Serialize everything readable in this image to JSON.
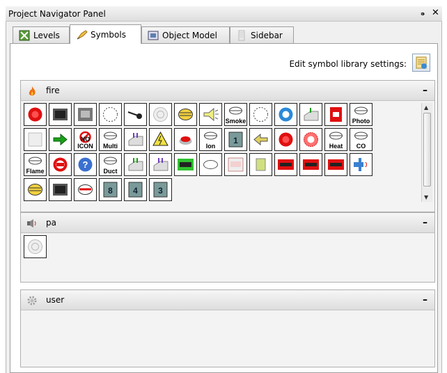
{
  "panel": {
    "title": "Project Navigator Panel",
    "float_icon": "restore-icon",
    "close_icon": "close-icon"
  },
  "tabs": [
    {
      "label": "Levels",
      "icon": "levels-icon",
      "active": false
    },
    {
      "label": "Symbols",
      "icon": "symbols-icon",
      "active": true
    },
    {
      "label": "Object Model",
      "icon": "object-model-icon",
      "active": false
    },
    {
      "label": "Sidebar",
      "icon": "sidebar-icon",
      "active": false
    }
  ],
  "settings": {
    "label": "Edit symbol library settings:",
    "icon": "settings-library-icon"
  },
  "sections": {
    "fire": {
      "label": "fire",
      "icon": "flame-icon",
      "minimize": "–"
    },
    "pa": {
      "label": "pa",
      "icon": "speaker-icon",
      "minimize": "–"
    },
    "user": {
      "label": "user",
      "icon": "gear-icon",
      "minimize": "–"
    }
  },
  "fire_symbols": [
    {
      "name": "red-light-symbol",
      "cap": ""
    },
    {
      "name": "panel-chip-symbol",
      "cap": ""
    },
    {
      "name": "control-panel-symbol",
      "cap": ""
    },
    {
      "name": "dotted-circle-symbol",
      "cap": ""
    },
    {
      "name": "pull-station-symbol",
      "cap": ""
    },
    {
      "name": "target-circle-symbol",
      "cap": ""
    },
    {
      "name": "yellow-detector-symbol",
      "cap": ""
    },
    {
      "name": "speaker-horn-symbol",
      "cap": ""
    },
    {
      "name": "smoke-detector-symbol",
      "cap": "Smoke"
    },
    {
      "name": "dotted-circle-2-symbol",
      "cap": ""
    },
    {
      "name": "blue-sensor-symbol",
      "cap": ""
    },
    {
      "name": "module-up-symbol",
      "cap": ""
    },
    {
      "name": "fire-alarm-box-symbol",
      "cap": ""
    },
    {
      "name": "photo-detector-symbol",
      "cap": "Photo"
    },
    {
      "name": "blank-panel-symbol",
      "cap": ""
    },
    {
      "name": "green-arrow-symbol",
      "cap": ""
    },
    {
      "name": "no-icon-symbol",
      "cap": "NO ICON"
    },
    {
      "name": "multi-detector-symbol",
      "cap": "Multi"
    },
    {
      "name": "module-arrows-symbol",
      "cap": ""
    },
    {
      "name": "high-voltage-symbol",
      "cap": ""
    },
    {
      "name": "red-button-symbol",
      "cap": ""
    },
    {
      "name": "ion-detector-symbol",
      "cap": "Ion"
    },
    {
      "name": "panel-1-symbol",
      "cap": "1"
    },
    {
      "name": "yellow-arrow-symbol",
      "cap": ""
    },
    {
      "name": "red-light-2-symbol",
      "cap": ""
    },
    {
      "name": "strobe-symbol",
      "cap": ""
    },
    {
      "name": "heat-detector-symbol",
      "cap": "Heat"
    },
    {
      "name": "co-detector-symbol",
      "cap": "CO"
    },
    {
      "name": "flame-detector-symbol",
      "cap": "Flame"
    },
    {
      "name": "red-ring-symbol",
      "cap": ""
    },
    {
      "name": "help-circle-symbol",
      "cap": ""
    },
    {
      "name": "duct-detector-symbol",
      "cap": "Duct"
    },
    {
      "name": "module-green-symbol",
      "cap": ""
    },
    {
      "name": "module-purple-symbol",
      "cap": ""
    },
    {
      "name": "green-panel-symbol",
      "cap": ""
    },
    {
      "name": "round-detector-symbol",
      "cap": ""
    },
    {
      "name": "zone-box-symbol",
      "cap": ""
    },
    {
      "name": "yellow-doc-symbol",
      "cap": ""
    },
    {
      "name": "red-device-1-symbol",
      "cap": ""
    },
    {
      "name": "red-device-2-symbol",
      "cap": ""
    },
    {
      "name": "red-device-3-symbol",
      "cap": ""
    },
    {
      "name": "valve-symbol",
      "cap": ""
    },
    {
      "name": "yellow-detector-2-symbol",
      "cap": ""
    },
    {
      "name": "chip-panel-2-symbol",
      "cap": ""
    },
    {
      "name": "red-detector-symbol",
      "cap": ""
    },
    {
      "name": "panel-8-symbol",
      "cap": "8"
    },
    {
      "name": "panel-4-symbol",
      "cap": "4"
    },
    {
      "name": "panel-3-symbol",
      "cap": "3"
    }
  ],
  "pa_symbols": [
    {
      "name": "pa-speaker-symbol",
      "cap": ""
    }
  ],
  "colors": {
    "accent_red": "#e01010",
    "accent_green": "#1aa01a",
    "border": "#222222"
  }
}
